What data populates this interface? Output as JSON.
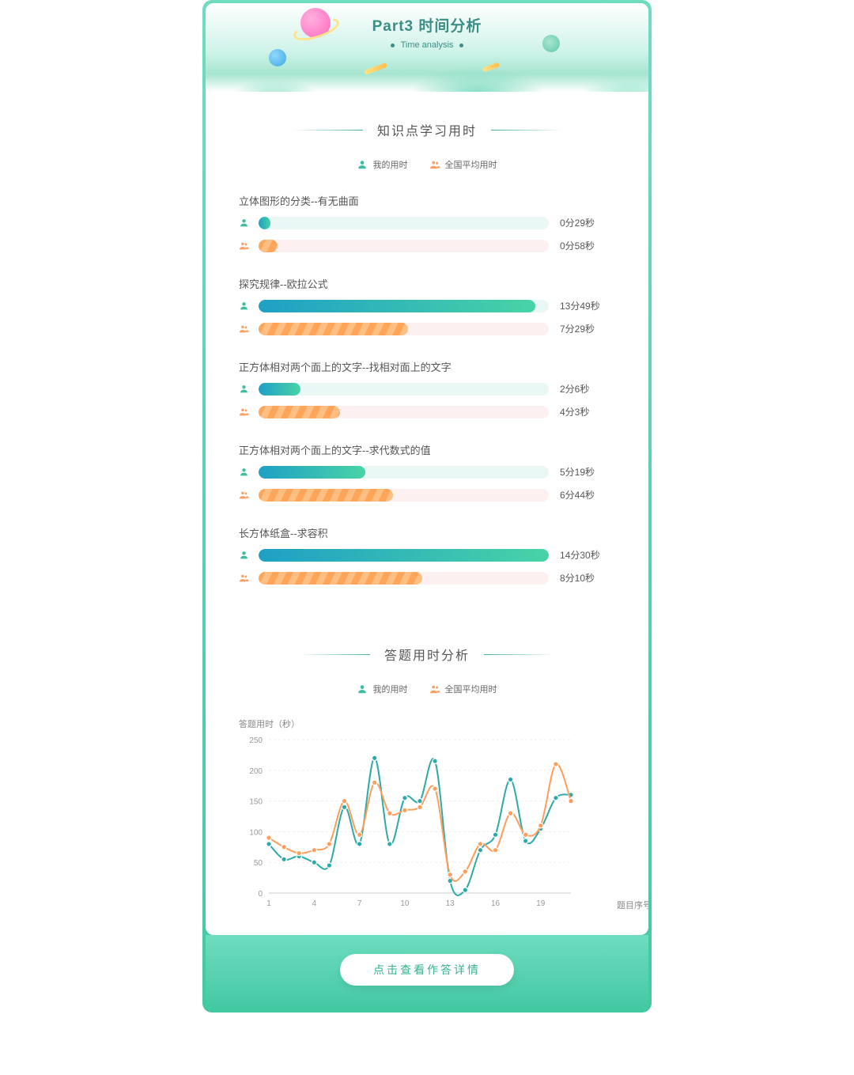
{
  "header": {
    "title": "Part3 时间分析",
    "subtitle": "Time analysis"
  },
  "section1": {
    "title": "知识点学习用时",
    "legend": {
      "mine": "我的用时",
      "avg": "全国平均用时"
    }
  },
  "knowledge": [
    {
      "name": "立体图形的分类--有无曲面",
      "mine_label": "0分29秒",
      "mine_sec": 29,
      "avg_label": "0分58秒",
      "avg_sec": 58
    },
    {
      "name": "探究规律--欧拉公式",
      "mine_label": "13分49秒",
      "mine_sec": 829,
      "avg_label": "7分29秒",
      "avg_sec": 449
    },
    {
      "name": "正方体相对两个面上的文字--找相对面上的文字",
      "mine_label": "2分6秒",
      "mine_sec": 126,
      "avg_label": "4分3秒",
      "avg_sec": 243
    },
    {
      "name": "正方体相对两个面上的文字--求代数式的值",
      "mine_label": "5分19秒",
      "mine_sec": 319,
      "avg_label": "6分44秒",
      "avg_sec": 404
    },
    {
      "name": "长方体纸盒--求容积",
      "mine_label": "14分30秒",
      "mine_sec": 870,
      "avg_label": "8分10秒",
      "avg_sec": 490
    }
  ],
  "section2": {
    "title": "答题用时分析",
    "legend": {
      "mine": "我的用时",
      "avg": "全国平均用时"
    }
  },
  "chart_data": {
    "type": "line",
    "title": "",
    "xlabel": "题目序号",
    "ylabel": "答题用时（秒）",
    "ylim": [
      0,
      250
    ],
    "yticks": [
      0,
      50,
      100,
      150,
      200,
      250
    ],
    "x": [
      1,
      2,
      3,
      4,
      5,
      6,
      7,
      8,
      9,
      10,
      11,
      12,
      13,
      14,
      15,
      16,
      17,
      18,
      19,
      20,
      21
    ],
    "xticks": [
      1,
      4,
      7,
      10,
      13,
      16,
      19
    ],
    "series": [
      {
        "name": "我的用时",
        "color": "#2caaa9",
        "values": [
          80,
          55,
          60,
          50,
          45,
          140,
          80,
          220,
          80,
          155,
          150,
          215,
          20,
          5,
          70,
          95,
          185,
          85,
          105,
          155,
          160
        ]
      },
      {
        "name": "全国平均用时",
        "color": "#ff9d5c",
        "values": [
          90,
          75,
          65,
          70,
          80,
          150,
          95,
          180,
          130,
          135,
          140,
          170,
          30,
          35,
          80,
          70,
          130,
          95,
          110,
          210,
          150
        ]
      }
    ]
  },
  "cta": "点击查看作答详情"
}
